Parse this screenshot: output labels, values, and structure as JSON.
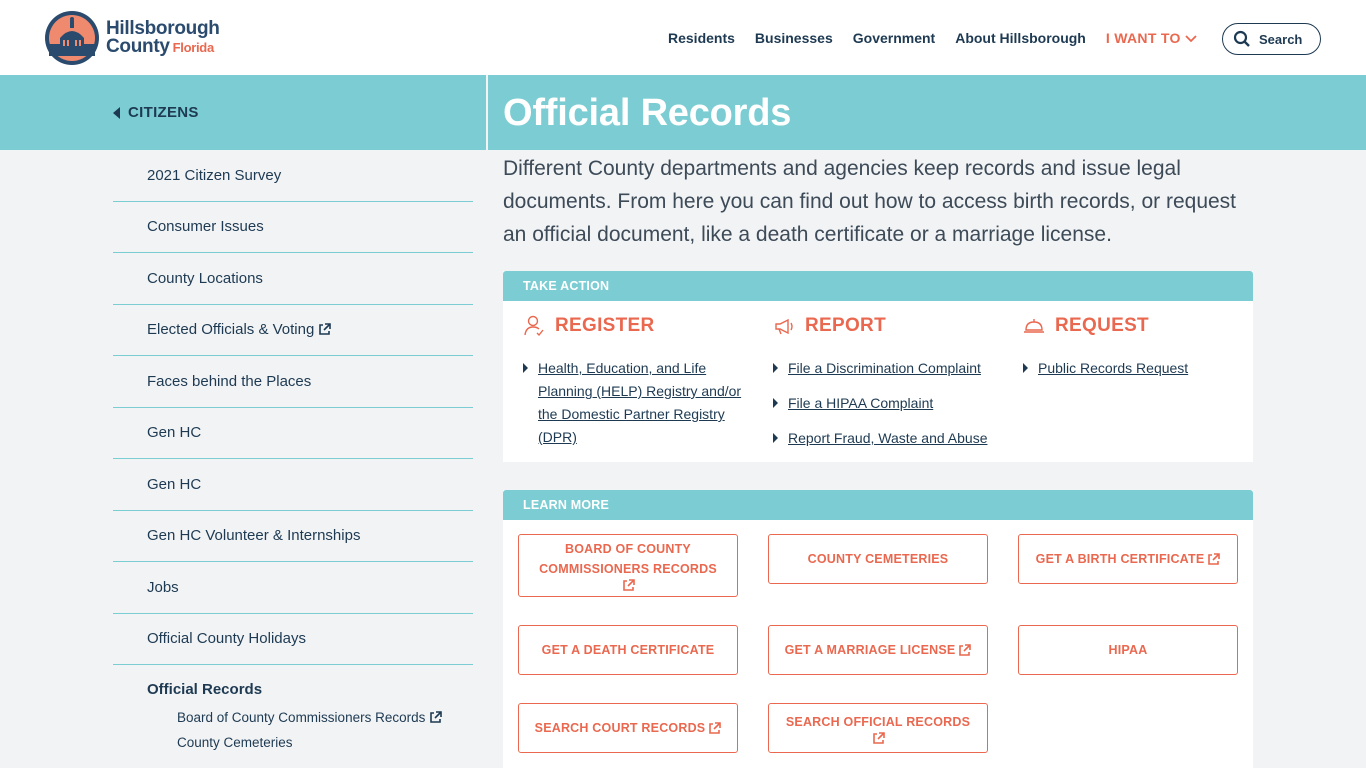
{
  "header": {
    "logo_line1": "Hillsborough",
    "logo_line2": "County",
    "logo_state": "Florida",
    "nav": [
      "Residents",
      "Businesses",
      "Government",
      "About Hillsborough"
    ],
    "want_label": "I WANT TO",
    "search_label": "Search"
  },
  "band": {
    "back_label": "CITIZENS",
    "title": "Official Records"
  },
  "sidebar": {
    "items": [
      {
        "label": "2021 Citizen Survey",
        "external": false
      },
      {
        "label": "Consumer Issues",
        "external": false
      },
      {
        "label": "County Locations",
        "external": false
      },
      {
        "label": "Elected Officials & Voting",
        "external": true
      },
      {
        "label": "Faces behind the Places",
        "external": false
      },
      {
        "label": "Gen HC",
        "external": false
      },
      {
        "label": "Gen HC",
        "external": false
      },
      {
        "label": "Gen HC Volunteer & Internships",
        "external": false
      },
      {
        "label": "Jobs",
        "external": false
      },
      {
        "label": "Official County Holidays",
        "external": false
      }
    ],
    "active": "Official Records",
    "sub_items": [
      {
        "label": "Board of County Commissioners Records",
        "external": true
      },
      {
        "label": "County Cemeteries",
        "external": false
      }
    ]
  },
  "intro": "Different County departments and agencies keep records and issue legal documents. From here you can find out how to access birth records, or request an official document, like a death certificate or a marriage license.",
  "take_action": {
    "heading": "TAKE ACTION",
    "columns": [
      {
        "title": "REGISTER",
        "icon": "person-register-icon",
        "links": [
          "Health, Education, and Life Planning (HELP) Registry and/or the Domestic Partner Registry (DPR)"
        ]
      },
      {
        "title": "REPORT",
        "icon": "megaphone-icon",
        "links": [
          "File a Discrimination Complaint",
          "File a HIPAA Complaint",
          "Report Fraud, Waste and Abuse"
        ]
      },
      {
        "title": "REQUEST",
        "icon": "service-bell-icon",
        "links": [
          "Public Records Request"
        ]
      }
    ]
  },
  "learn_more": {
    "heading": "LEARN MORE",
    "buttons": [
      {
        "label": "BOARD OF COUNTY COMMISSIONERS RECORDS",
        "external": true
      },
      {
        "label": "COUNTY CEMETERIES",
        "external": false
      },
      {
        "label": "GET A BIRTH CERTIFICATE",
        "external": true
      },
      {
        "label": "GET A DEATH CERTIFICATE",
        "external": false
      },
      {
        "label": "GET A MARRIAGE LICENSE",
        "external": true
      },
      {
        "label": "HIPAA",
        "external": false
      },
      {
        "label": "SEARCH COURT RECORDS",
        "external": true
      },
      {
        "label": "SEARCH OFFICIAL RECORDS",
        "external": true
      }
    ]
  },
  "colors": {
    "teal": "#7ccdd3",
    "navy": "#1e3a52",
    "coral": "#e9684f",
    "background": "#f1f3f5"
  }
}
